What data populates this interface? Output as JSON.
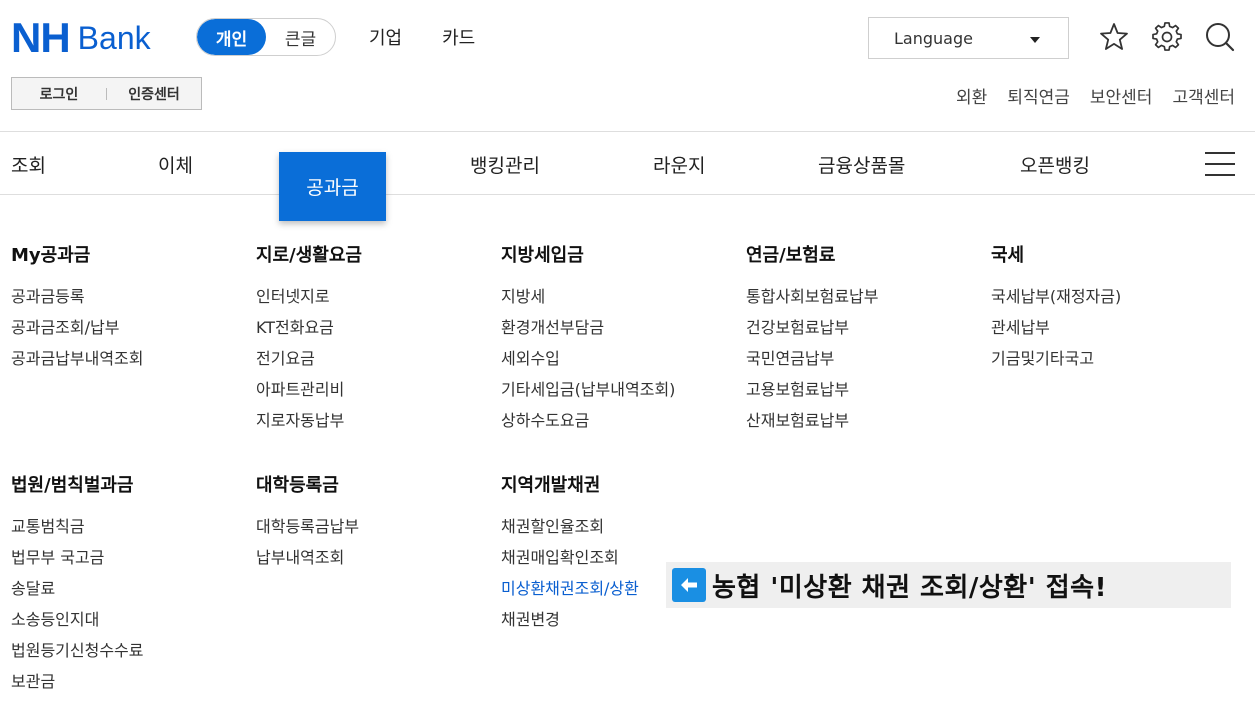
{
  "brand": {
    "nh": "NH",
    "bank": "Bank",
    "color": "#0a5fd0"
  },
  "segment": {
    "personal": "개인",
    "large": "큰글"
  },
  "top_nav": [
    "기업",
    "카드"
  ],
  "language": {
    "label": "Language"
  },
  "icons": {
    "favorite": "star-icon",
    "settings": "gear-icon",
    "search": "search-icon"
  },
  "auth": {
    "login": "로그인",
    "cert": "인증센터"
  },
  "util_nav": [
    "외환",
    "퇴직연금",
    "보안센터",
    "고객센터"
  ],
  "main_nav": {
    "items": [
      "조회",
      "이체",
      "공과금",
      "뱅킹관리",
      "라운지",
      "금융상품몰",
      "오픈뱅킹"
    ],
    "active": "공과금",
    "accent": "#0a6ed8"
  },
  "menu": [
    {
      "heading": "My공과금",
      "items": [
        "공과금등록",
        "공과금조회/납부",
        "공과금납부내역조회"
      ]
    },
    {
      "heading": "지로/생활요금",
      "items": [
        "인터넷지로",
        "KT전화요금",
        "전기요금",
        "아파트관리비",
        "지로자동납부"
      ]
    },
    {
      "heading": "지방세입금",
      "items": [
        "지방세",
        "환경개선부담금",
        "세외수입",
        "기타세입금(납부내역조회)",
        "상하수도요금"
      ]
    },
    {
      "heading": "연금/보험료",
      "items": [
        "통합사회보험료납부",
        "건강보험료납부",
        "국민연금납부",
        "고용보험료납부",
        "산재보험료납부"
      ]
    },
    {
      "heading": "국세",
      "items": [
        "국세납부(재정자금)",
        "관세납부",
        "기금및기타국고"
      ]
    },
    {
      "heading": "법원/범칙벌과금",
      "items": [
        "교통범칙금",
        "법무부 국고금",
        "송달료",
        "소송등인지대",
        "법원등기신청수수료",
        "보관금"
      ]
    },
    {
      "heading": "대학등록금",
      "items": [
        "대학등록금납부",
        "납부내역조회"
      ]
    },
    {
      "heading": "지역개발채권",
      "items": [
        "채권할인율조회",
        "채권매입확인조회",
        "미상환채권조회/상환",
        "채권변경"
      ],
      "highlight": 2
    }
  ],
  "annotation": {
    "text": "농협 '미상환 채권 조회/상환' 접속!"
  }
}
